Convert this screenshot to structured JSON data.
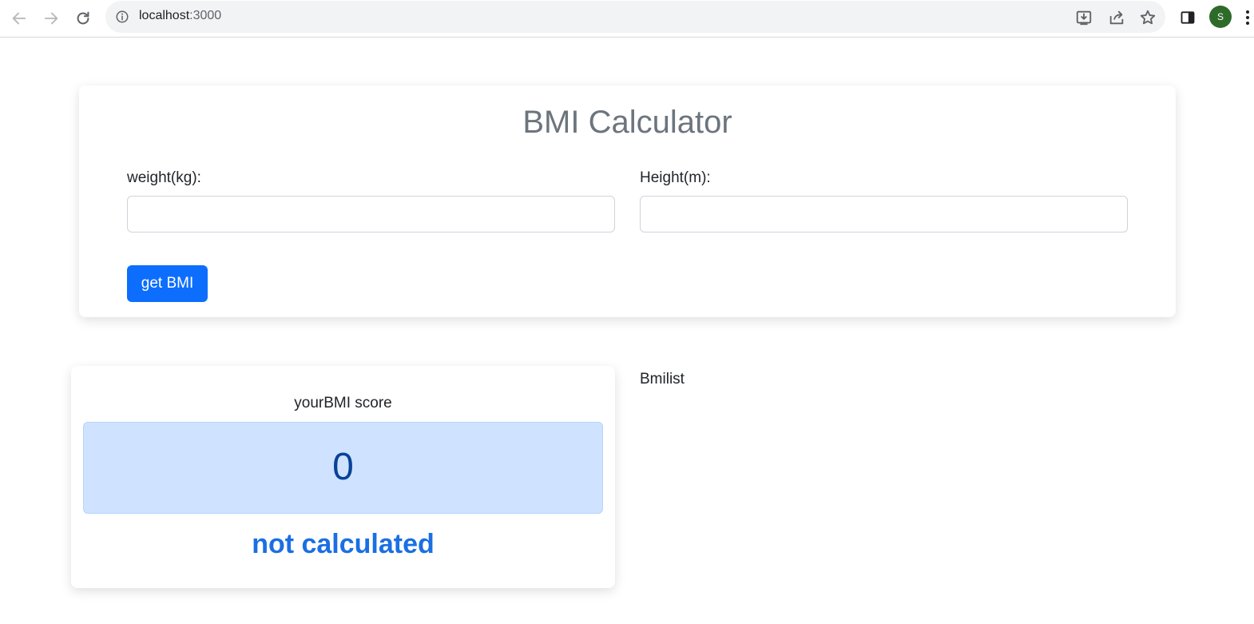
{
  "browser": {
    "url_host": "localhost",
    "url_port": ":3000",
    "profile_initial": "S"
  },
  "calculator": {
    "title": "BMI Calculator",
    "weight_label": "weight(kg):",
    "weight_value": "",
    "height_label": "Height(m):",
    "height_value": "",
    "submit_label": "get BMI",
    "accent_color": "#0d6efd"
  },
  "result": {
    "heading": "yourBMI score",
    "score": "0",
    "status": "not calculated",
    "box_color": "#cfe2ff",
    "status_color": "#1a6fe3"
  },
  "list": {
    "label": "Bmilist"
  }
}
